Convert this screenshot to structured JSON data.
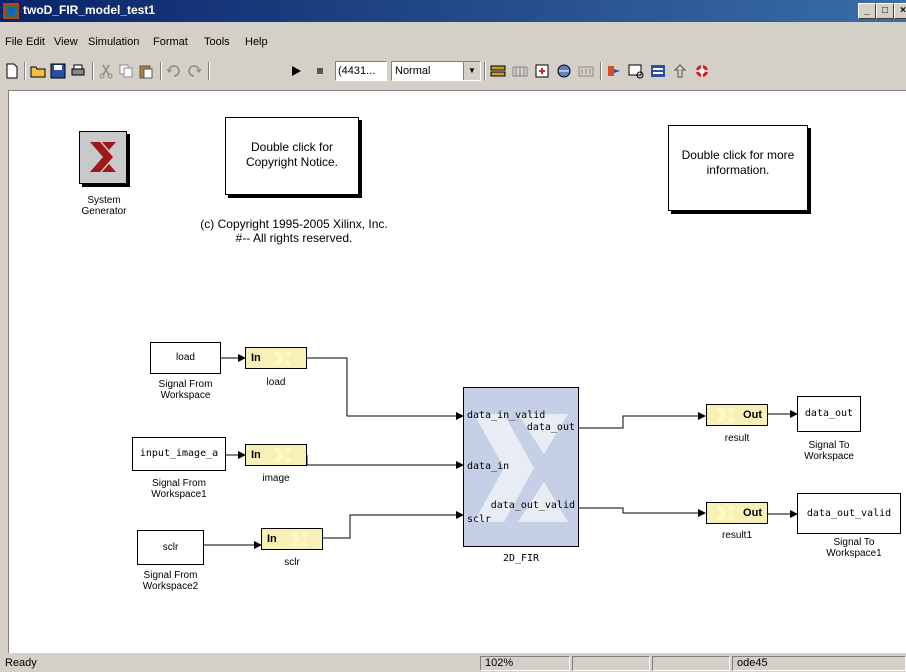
{
  "window": {
    "title": "twoD_FIR_model_test1"
  },
  "menu": [
    "File",
    "Edit",
    "View",
    "Simulation",
    "Format",
    "Tools",
    "Help"
  ],
  "toolbar": {
    "stop_time": "(4431...",
    "sim_mode": "Normal"
  },
  "canvas": {
    "logo_label": "System Generator",
    "copyright_box": "Double click for Copyright Notice.",
    "copyright_text": "(c) Copyright 1995-2005 Xilinx, Inc.",
    "rights_text": "#-- All rights reserved.",
    "info_box": "Double click for more information.",
    "blocks": {
      "load_src": "load",
      "load_src_label": "Signal From Workspace",
      "load_in": "In",
      "load_in_label": "load",
      "image_src": "input_image_a",
      "image_src_label": "Signal From Workspace1",
      "image_in": "In",
      "image_in_label": "image",
      "sclr_src": "sclr",
      "sclr_src_label": "Signal From Workspace2",
      "sclr_in": "In",
      "sclr_in_label": "sclr",
      "fir_port_in_valid": "data_in_valid",
      "fir_port_data_in": "data_in",
      "fir_port_sclr": "sclr",
      "fir_port_data_out": "data_out",
      "fir_port_out_valid": "data_out_valid",
      "fir_label": "2D_FIR",
      "out1": "Out",
      "out1_label": "result",
      "out2": "Out",
      "out2_label": "result1",
      "sink1": "data_out",
      "sink1_label": "Signal To Workspace",
      "sink2": "data_out_valid",
      "sink2_label": "Signal To Workspace1"
    }
  },
  "status": {
    "ready": "Ready",
    "zoom": "102%",
    "solver": "ode45"
  }
}
